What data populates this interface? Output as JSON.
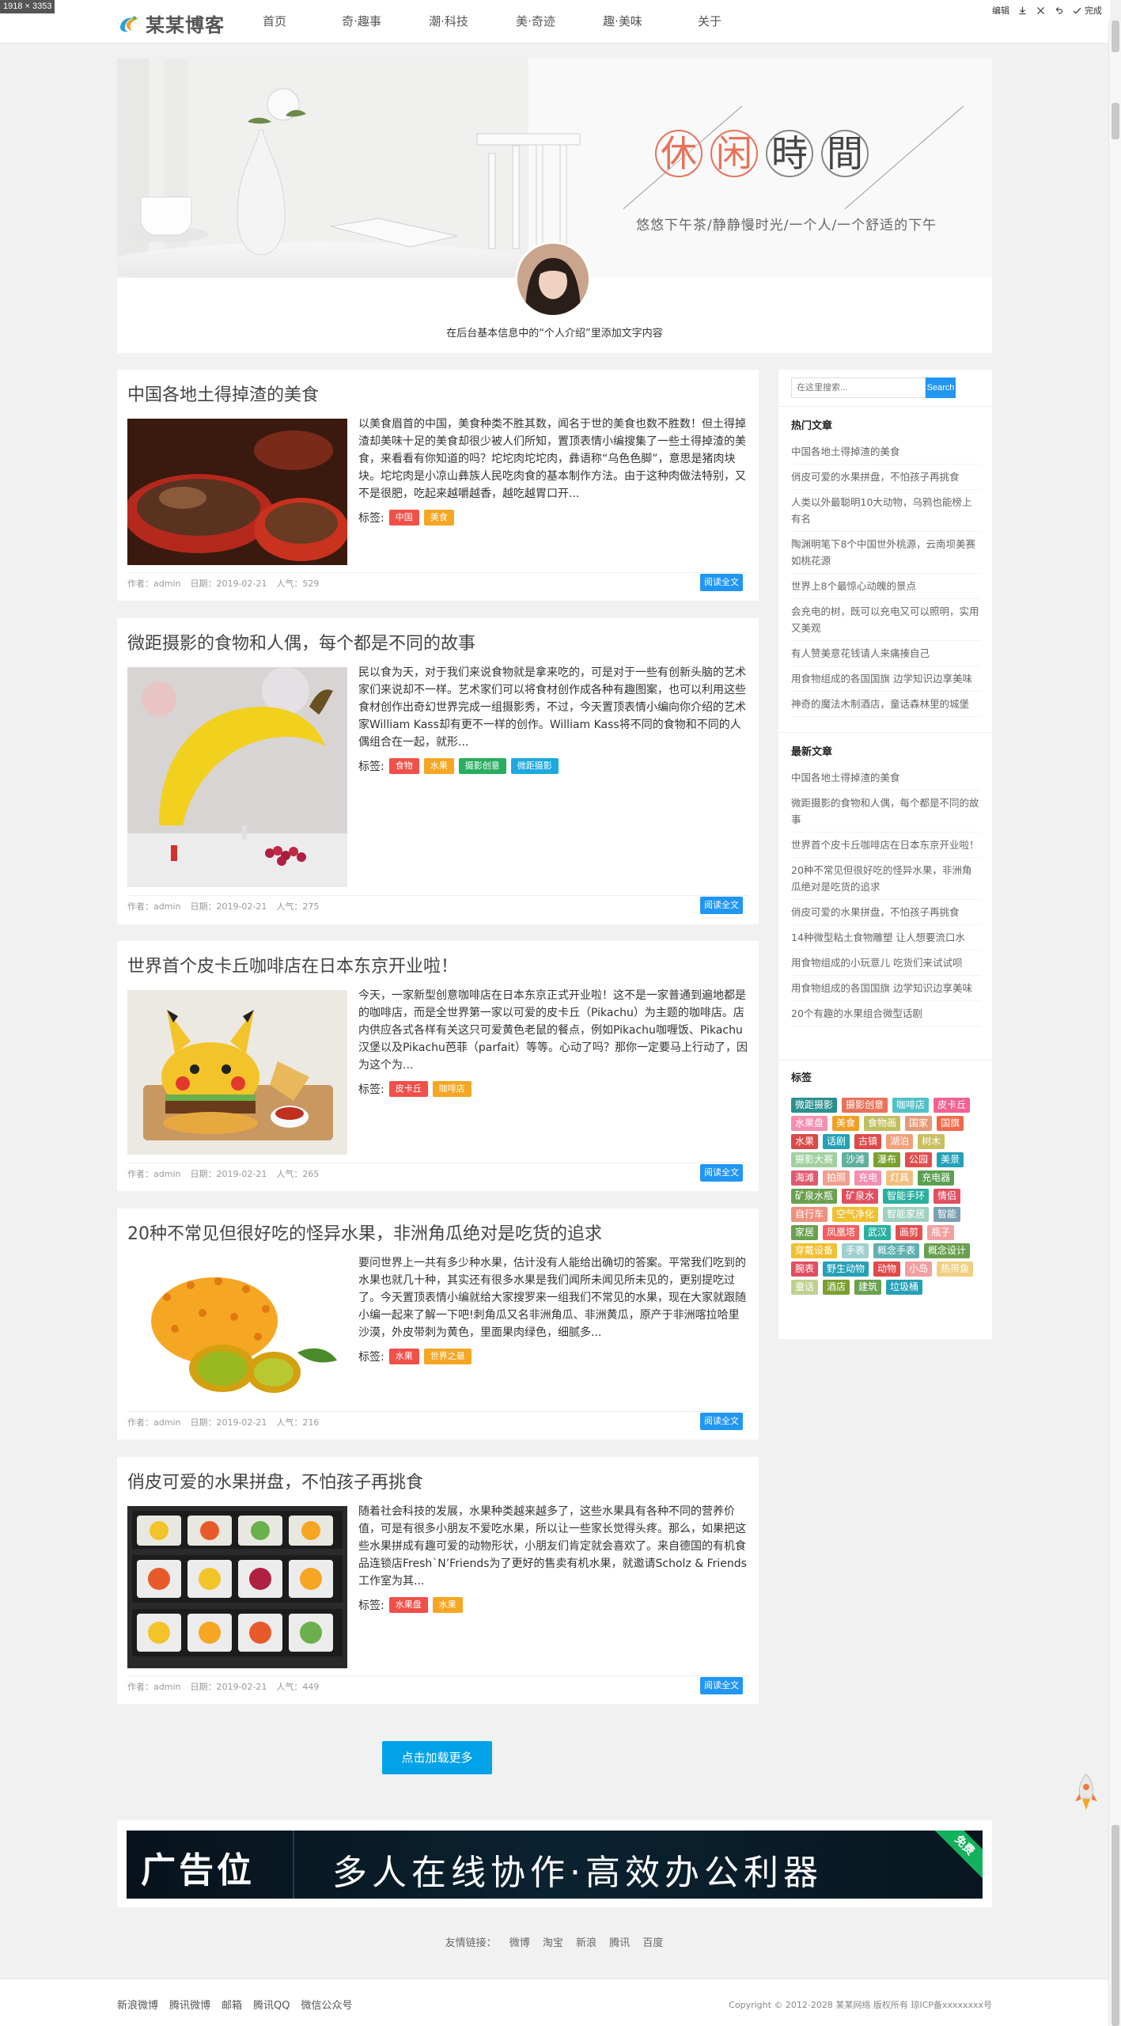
{
  "window": {
    "dimensions_badge": "1918 × 3353"
  },
  "toolbar": {
    "edit": "编辑",
    "done": "完成"
  },
  "site": {
    "logo_text": "某某博客"
  },
  "nav": [
    "首页",
    "奇·趣事",
    "潮·科技",
    "美·奇迹",
    "趣·美味",
    "关于"
  ],
  "banner": {
    "title_chars": [
      "休",
      "闲",
      "時",
      "間"
    ],
    "subtitle": "悠悠下午茶/静静慢时光/一个人/一个舒适的下午",
    "intro": "在后台基本信息中的“个人介绍”里添加文字内容"
  },
  "article_labels": {
    "tags": "标签:",
    "author": "作者：admin",
    "readmore": "阅读全文"
  },
  "articles": [
    {
      "title": "中国各地土得掉渣的美食",
      "excerpt": "以美食眉首的中国，美食种类不胜其数，闻名于世的美食也数不胜数！但土得掉渣却美味十足的美食却很少被人们所知，置顶表情小编搜集了一些土得掉渣的美食，来看看有你知道的吗？坨坨肉坨坨肉，彝语称“乌色色脚”，意思是猪肉块块。坨坨肉是小凉山彝族人民吃肉食的基本制作方法。由于这种肉做法特别，又不是很肥，吃起来越嚼越香，越吃越胃口开...",
      "tags": [
        "中国",
        "美食"
      ],
      "date": "日期：2019-02-21",
      "views": "人气：529"
    },
    {
      "title": "微距摄影的食物和人偶，每个都是不同的故事",
      "excerpt": "民以食为天，对于我们来说食物就是拿来吃的，可是对于一些有创新头脑的艺术家们来说却不一样。艺术家们可以将食材创作成各种有趣图案，也可以利用这些食材创作出奇幻世界完成一组摄影秀，不过，今天置顶表情小编向你介绍的艺术家William Kass却有更不一样的创作。William Kass将不同的食物和不同的人偶组合在一起，就形...",
      "tags": [
        "食物",
        "水果",
        "摄影创意",
        "微距摄影"
      ],
      "date": "日期：2019-02-21",
      "views": "人气：275"
    },
    {
      "title": "世界首个皮卡丘咖啡店在日本东京开业啦！",
      "excerpt": "今天，一家新型创意咖啡店在日本东京正式开业啦！这不是一家普通到遍地都是的咖啡店，而是全世界第一家以可爱的皮卡丘（Pikachu）为主题的咖啡店。店内供应各式各样有关这只可爱黄色老鼠的餐点，例如Pikachu咖喱饭、Pikachu汉堡以及Pikachu芭菲（parfait）等等。心动了吗？那你一定要马上行动了，因为这个为...",
      "tags": [
        "皮卡丘",
        "咖啡店"
      ],
      "date": "日期：2019-02-21",
      "views": "人气：265"
    },
    {
      "title": "20种不常见但很好吃的怪异水果，非洲角瓜绝对是吃货的追求",
      "excerpt": "要问世界上一共有多少种水果，估计没有人能给出确切的答案。平常我们吃到的水果也就几十种，其实还有很多水果是我们闻所未闻见所未见的，更别提吃过了。今天置顶表情小编就给大家搜罗来一组我们不常见的水果，现在大家就跟随小编一起来了解一下吧!刺角瓜又名非洲角瓜、非洲黄瓜，原产于非洲喀拉哈里沙漠，外皮带刺为黄色，里面果肉绿色，细腻多...",
      "tags": [
        "水果",
        "世界之最"
      ],
      "date": "日期：2019-02-21",
      "views": "人气：216"
    },
    {
      "title": "俏皮可爱的水果拼盘，不怕孩子再挑食",
      "excerpt": "随着社会科技的发展，水果种类越来越多了，这些水果具有各种不同的营养价值，可是有很多小朋友不爱吃水果，所以让一些家长觉得头疼。那么，如果把这些水果拼成有趣可爱的动物形状，小朋友们肯定就会喜欢了。来自德国的有机食品连锁店Fresh`N’Friends为了更好的售卖有机水果，就邀请Scholz & Friends工作室为其...",
      "tags": [
        "水果盘",
        "水果"
      ],
      "date": "日期：2019-02-21",
      "views": "人气：449"
    }
  ],
  "sidebar": {
    "search_placeholder": "在这里搜索...",
    "search_button": "Search",
    "hot_title": "热门文章",
    "hot": [
      "中国各地土得掉渣的美食",
      "俏皮可爱的水果拼盘，不怕孩子再挑食",
      "人类以外最聪明10大动物，乌鸦也能榜上有名",
      "陶渊明笔下8个中国世外桃源，云南坝美赛如桃花源",
      "世界上8个最惊心动魄的景点",
      "会充电的树，既可以充电又可以照明，实用又美观",
      "有人赞美意花钱请人来痛揍自己",
      "用食物组成的各国国旗 边学知识边享美味",
      "神奇的魔法木制酒店，童话森林里的城堡"
    ],
    "new_title": "最新文章",
    "new": [
      "中国各地土得掉渣的美食",
      "微距摄影的食物和人偶，每个都是不同的故事",
      "世界首个皮卡丘咖啡店在日本东京开业啦！",
      "20种不常见但很好吃的怪异水果，非洲角瓜绝对是吃货的追求",
      "俏皮可爱的水果拼盘，不怕孩子再挑食",
      "14种微型粘土食物雕塑 让人想要流口水",
      "用食物组成的小玩意儿 吃货们来试试呗",
      "用食物组成的各国国旗 边学知识边享美味",
      "20个有趣的水果组合微型话剧"
    ],
    "tags_title": "标签",
    "tagcloud": [
      {
        "t": "微距摄影",
        "c": "#2a8f8f"
      },
      {
        "t": "摄影创意",
        "c": "#e8725a"
      },
      {
        "t": "咖啡店",
        "c": "#4fc1c9"
      },
      {
        "t": "皮卡丘",
        "c": "#f06292"
      },
      {
        "t": "水果盘",
        "c": "#f48fb1"
      },
      {
        "t": "美食",
        "c": "#f0a020"
      },
      {
        "t": "食物画",
        "c": "#c0c060"
      },
      {
        "t": "国家",
        "c": "#e39a7a"
      },
      {
        "t": "国旗",
        "c": "#f06a4a"
      },
      {
        "t": "水果",
        "c": "#d94a4a"
      },
      {
        "t": "话剧",
        "c": "#26a0b5"
      },
      {
        "t": "古镇",
        "c": "#e04a4a"
      },
      {
        "t": "湖泊",
        "c": "#f0a07a"
      },
      {
        "t": "树木",
        "c": "#c8c060"
      },
      {
        "t": "摄影大赛",
        "c": "#a0d0a0"
      },
      {
        "t": "沙滩",
        "c": "#60b0a0"
      },
      {
        "t": "瀑布",
        "c": "#7aa030"
      },
      {
        "t": "公园",
        "c": "#e05050"
      },
      {
        "t": "美景",
        "c": "#26a0b5"
      },
      {
        "t": "海滩",
        "c": "#e05a70"
      },
      {
        "t": "拍照",
        "c": "#f0a090"
      },
      {
        "t": "充电",
        "c": "#f48fb1"
      },
      {
        "t": "灯具",
        "c": "#f0c080"
      },
      {
        "t": "充电器",
        "c": "#5aa050"
      },
      {
        "t": "矿泉水瓶",
        "c": "#6aa050"
      },
      {
        "t": "矿泉水",
        "c": "#e05060"
      },
      {
        "t": "智能手环",
        "c": "#2bb0a0"
      },
      {
        "t": "情侣",
        "c": "#e05060"
      },
      {
        "t": "自行车",
        "c": "#f09080"
      },
      {
        "t": "空气净化",
        "c": "#f0c030"
      },
      {
        "t": "智能家居",
        "c": "#a0d0c0"
      },
      {
        "t": "智能",
        "c": "#7aa0b0"
      },
      {
        "t": "家居",
        "c": "#6aa050"
      },
      {
        "t": "凤凰塔",
        "c": "#f06060"
      },
      {
        "t": "武汉",
        "c": "#2bb0a0"
      },
      {
        "t": "画剪",
        "c": "#e05050"
      },
      {
        "t": "瓶子",
        "c": "#f0a0a0"
      },
      {
        "t": "穿戴设备",
        "c": "#f0c030"
      },
      {
        "t": "手表",
        "c": "#a0d0d0"
      },
      {
        "t": "概念手表",
        "c": "#60b0b0"
      },
      {
        "t": "概念设计",
        "c": "#6aa050"
      },
      {
        "t": "腕表",
        "c": "#e05060"
      },
      {
        "t": "野生动物",
        "c": "#26a0b5"
      },
      {
        "t": "动物",
        "c": "#e04a4a"
      },
      {
        "t": "小岛",
        "c": "#f0a0a0"
      },
      {
        "t": "热带鱼",
        "c": "#f0d080"
      },
      {
        "t": "童话",
        "c": "#c0d090"
      },
      {
        "t": "酒店",
        "c": "#7aa030"
      },
      {
        "t": "建筑",
        "c": "#6aa050"
      },
      {
        "t": "垃圾桶",
        "c": "#26a0b5"
      }
    ]
  },
  "load_more": "点击加载更多",
  "ad": {
    "label": "广告位",
    "slogan": "多人在线协作·高效办公利器",
    "corner": "免费"
  },
  "friends": {
    "label": "友情链接：",
    "links": [
      "微博",
      "淘宝",
      "新浪",
      "腾讯",
      "百度"
    ]
  },
  "footer": {
    "links": [
      "新浪微博",
      "腾讯微博",
      "邮箱",
      "腾讯QQ",
      "微信公众号"
    ],
    "copyright": "Copyright © 2012-2028 某某网络 版权所有 琼ICP备xxxxxxxx号"
  },
  "colors": {
    "accent_blue": "#2196f3",
    "tag_red": "#f0504a",
    "tag_orange": "#f5a623",
    "tag_green": "#27ae60",
    "tag_cyan": "#1ba9e1"
  }
}
